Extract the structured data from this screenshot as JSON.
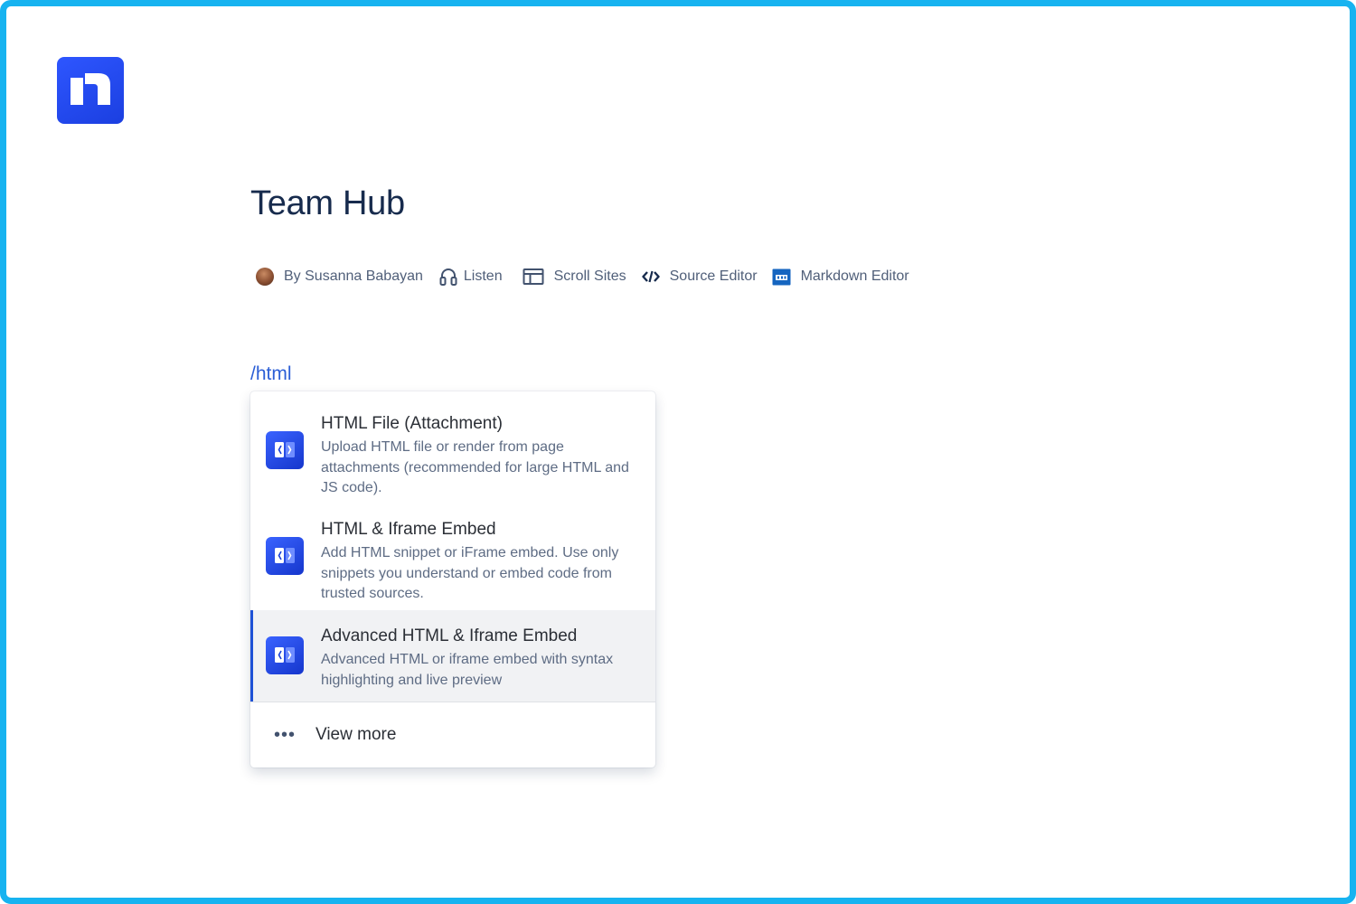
{
  "app": {
    "logo_icon": "confluence-style-logo-icon"
  },
  "page": {
    "title": "Team Hub"
  },
  "byline": {
    "author": "By Susanna Babayan",
    "listen": "Listen",
    "scroll_sites": "Scroll Sites",
    "source_editor": "Source Editor",
    "markdown_editor": "Markdown Editor",
    "icons": [
      "avatar",
      "headphones-icon",
      "layout-icon",
      "code-icon",
      "markdown-icon"
    ]
  },
  "editor": {
    "slash_command": "/html"
  },
  "menu": {
    "items": [
      {
        "title": "HTML File (Attachment)",
        "description": "Upload HTML file or render from page attachments (recommended for large HTML and JS code).",
        "icon": "html-macro-icon",
        "selected": false
      },
      {
        "title": "HTML & Iframe Embed",
        "description": "Add HTML snippet or iFrame embed. Use only snippets you understand or embed code from trusted sources.",
        "icon": "html-macro-icon",
        "selected": false
      },
      {
        "title": "Advanced HTML & Iframe Embed",
        "description": "Advanced HTML or iframe embed with syntax highlighting and live preview",
        "icon": "html-macro-icon",
        "selected": true
      }
    ],
    "view_more": {
      "icon": "ellipsis-icon",
      "label": "View more"
    }
  },
  "colors": {
    "frame_border": "#17b3f0",
    "brand_blue": "#1f52d6",
    "slash_text": "#2c5fd6",
    "selected_bg": "#f1f2f4"
  }
}
